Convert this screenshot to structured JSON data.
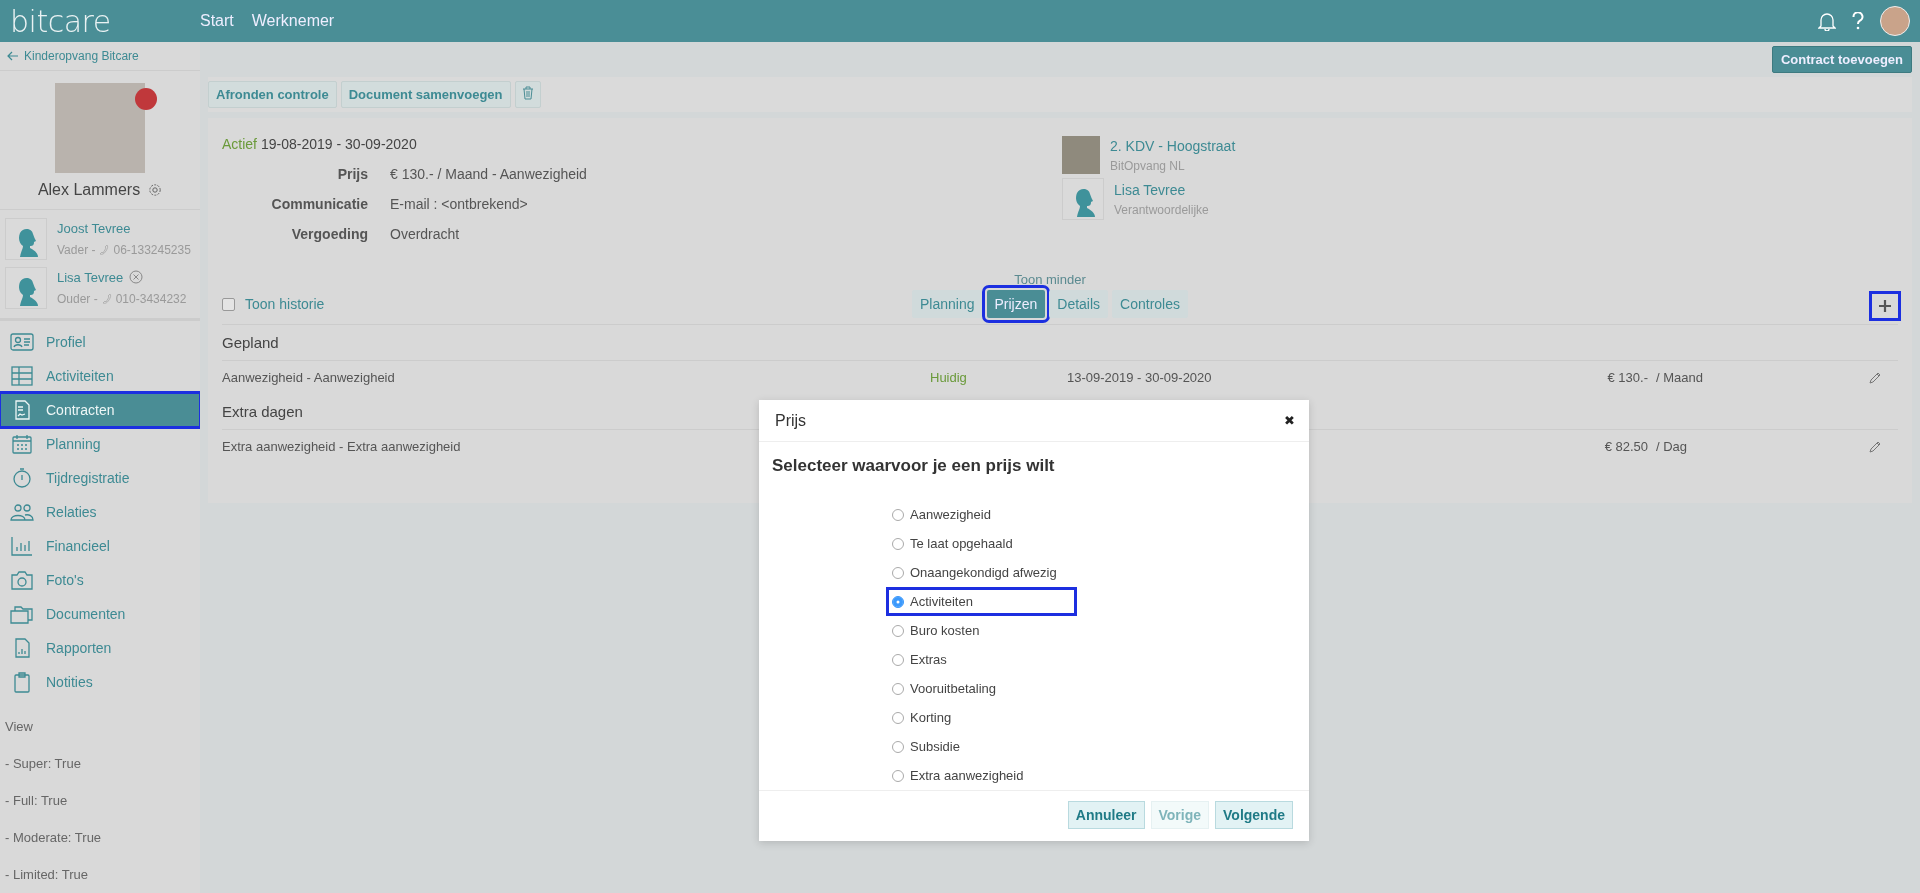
{
  "topbar": {
    "logo": "bitcare",
    "nav": [
      {
        "label": "Start"
      },
      {
        "label": "Werknemer"
      }
    ]
  },
  "sidebar": {
    "back_link": "Kinderopvang Bitcare",
    "child_name": "Alex Lammers",
    "relations": [
      {
        "name": "Joost Tevree",
        "role": "Vader -",
        "phone": "06-133245235",
        "removable": false
      },
      {
        "name": "Lisa Tevree",
        "role": "Ouder -",
        "phone": "010-3434232",
        "removable": true
      }
    ],
    "nav": [
      {
        "label": "Profiel",
        "selected": false,
        "highlighted": false
      },
      {
        "label": "Activiteiten",
        "selected": false,
        "highlighted": false
      },
      {
        "label": "Contracten",
        "selected": true,
        "highlighted": true
      },
      {
        "label": "Planning",
        "selected": false,
        "highlighted": false
      },
      {
        "label": "Tijdregistratie",
        "selected": false,
        "highlighted": false
      },
      {
        "label": "Relaties",
        "selected": false,
        "highlighted": false
      },
      {
        "label": "Financieel",
        "selected": false,
        "highlighted": false
      },
      {
        "label": "Foto's",
        "selected": false,
        "highlighted": false
      },
      {
        "label": "Documenten",
        "selected": false,
        "highlighted": false
      },
      {
        "label": "Rapporten",
        "selected": false,
        "highlighted": false
      },
      {
        "label": "Notities",
        "selected": false,
        "highlighted": false
      }
    ],
    "view": {
      "title": "View",
      "lines": [
        "- Super: True",
        "- Full: True",
        "- Moderate: True",
        "- Limited: True"
      ]
    }
  },
  "main": {
    "add_button": "Contract toevoegen",
    "toolbar": [
      {
        "label": "Afronden controle"
      },
      {
        "label": "Document samenvoegen"
      }
    ],
    "contract": {
      "status": "Actief",
      "period": "19-08-2019 - 30-09-2020",
      "fields": [
        {
          "label": "Prijs",
          "value": "€ 130.- / Maand - Aanwezigheid"
        },
        {
          "label": "Communicatie",
          "value": "E-mail : <ontbrekend>"
        },
        {
          "label": "Vergoeding",
          "value": "Overdracht"
        }
      ],
      "location": {
        "name": "2. KDV - Hoogstraat",
        "org": "BitOpvang NL"
      },
      "contact": {
        "name": "Lisa Tevree",
        "role": "Verantwoordelijke"
      }
    },
    "toggle_link": "Toon minder",
    "history": {
      "label": "Toon historie",
      "checked": false
    },
    "tabs": [
      {
        "label": "Planning",
        "selected": false,
        "highlighted": false
      },
      {
        "label": "Prijzen",
        "selected": true,
        "highlighted": true
      },
      {
        "label": "Details",
        "selected": false,
        "highlighted": false
      },
      {
        "label": "Controles",
        "selected": false,
        "highlighted": false
      }
    ],
    "add_highlighted": true,
    "sections": [
      {
        "title": "Gepland",
        "rows": [
          {
            "name": "Aanwezigheid - Aanwezigheid",
            "status": "Huidig",
            "period": "13-09-2019 - 30-09-2020",
            "amount": "€ 130.-",
            "unit": "/ Maand"
          }
        ]
      },
      {
        "title": "Extra dagen",
        "rows": [
          {
            "name": "Extra aanwezigheid - Extra aanwezigheid",
            "amount": "€ 82.50",
            "unit": "/ Dag"
          }
        ]
      }
    ]
  },
  "modal": {
    "title": "Prijs",
    "close": "✖",
    "heading": "Selecteer waarvoor je een prijs wilt",
    "options": [
      {
        "label": "Aanwezigheid",
        "selected": false,
        "highlighted": false
      },
      {
        "label": "Te laat opgehaald",
        "selected": false,
        "highlighted": false
      },
      {
        "label": "Onaangekondigd afwezig",
        "selected": false,
        "highlighted": false
      },
      {
        "label": "Activiteiten",
        "selected": true,
        "highlighted": true
      },
      {
        "label": "Buro kosten",
        "selected": false,
        "highlighted": false
      },
      {
        "label": "Extras",
        "selected": false,
        "highlighted": false
      },
      {
        "label": "Vooruitbetaling",
        "selected": false,
        "highlighted": false
      },
      {
        "label": "Korting",
        "selected": false,
        "highlighted": false
      },
      {
        "label": "Subsidie",
        "selected": false,
        "highlighted": false
      },
      {
        "label": "Extra aanwezigheid",
        "selected": false,
        "highlighted": false
      }
    ],
    "buttons": [
      {
        "label": "Annuleer",
        "disabled": false
      },
      {
        "label": "Vorige",
        "disabled": true
      },
      {
        "label": "Volgende",
        "disabled": false
      }
    ]
  }
}
